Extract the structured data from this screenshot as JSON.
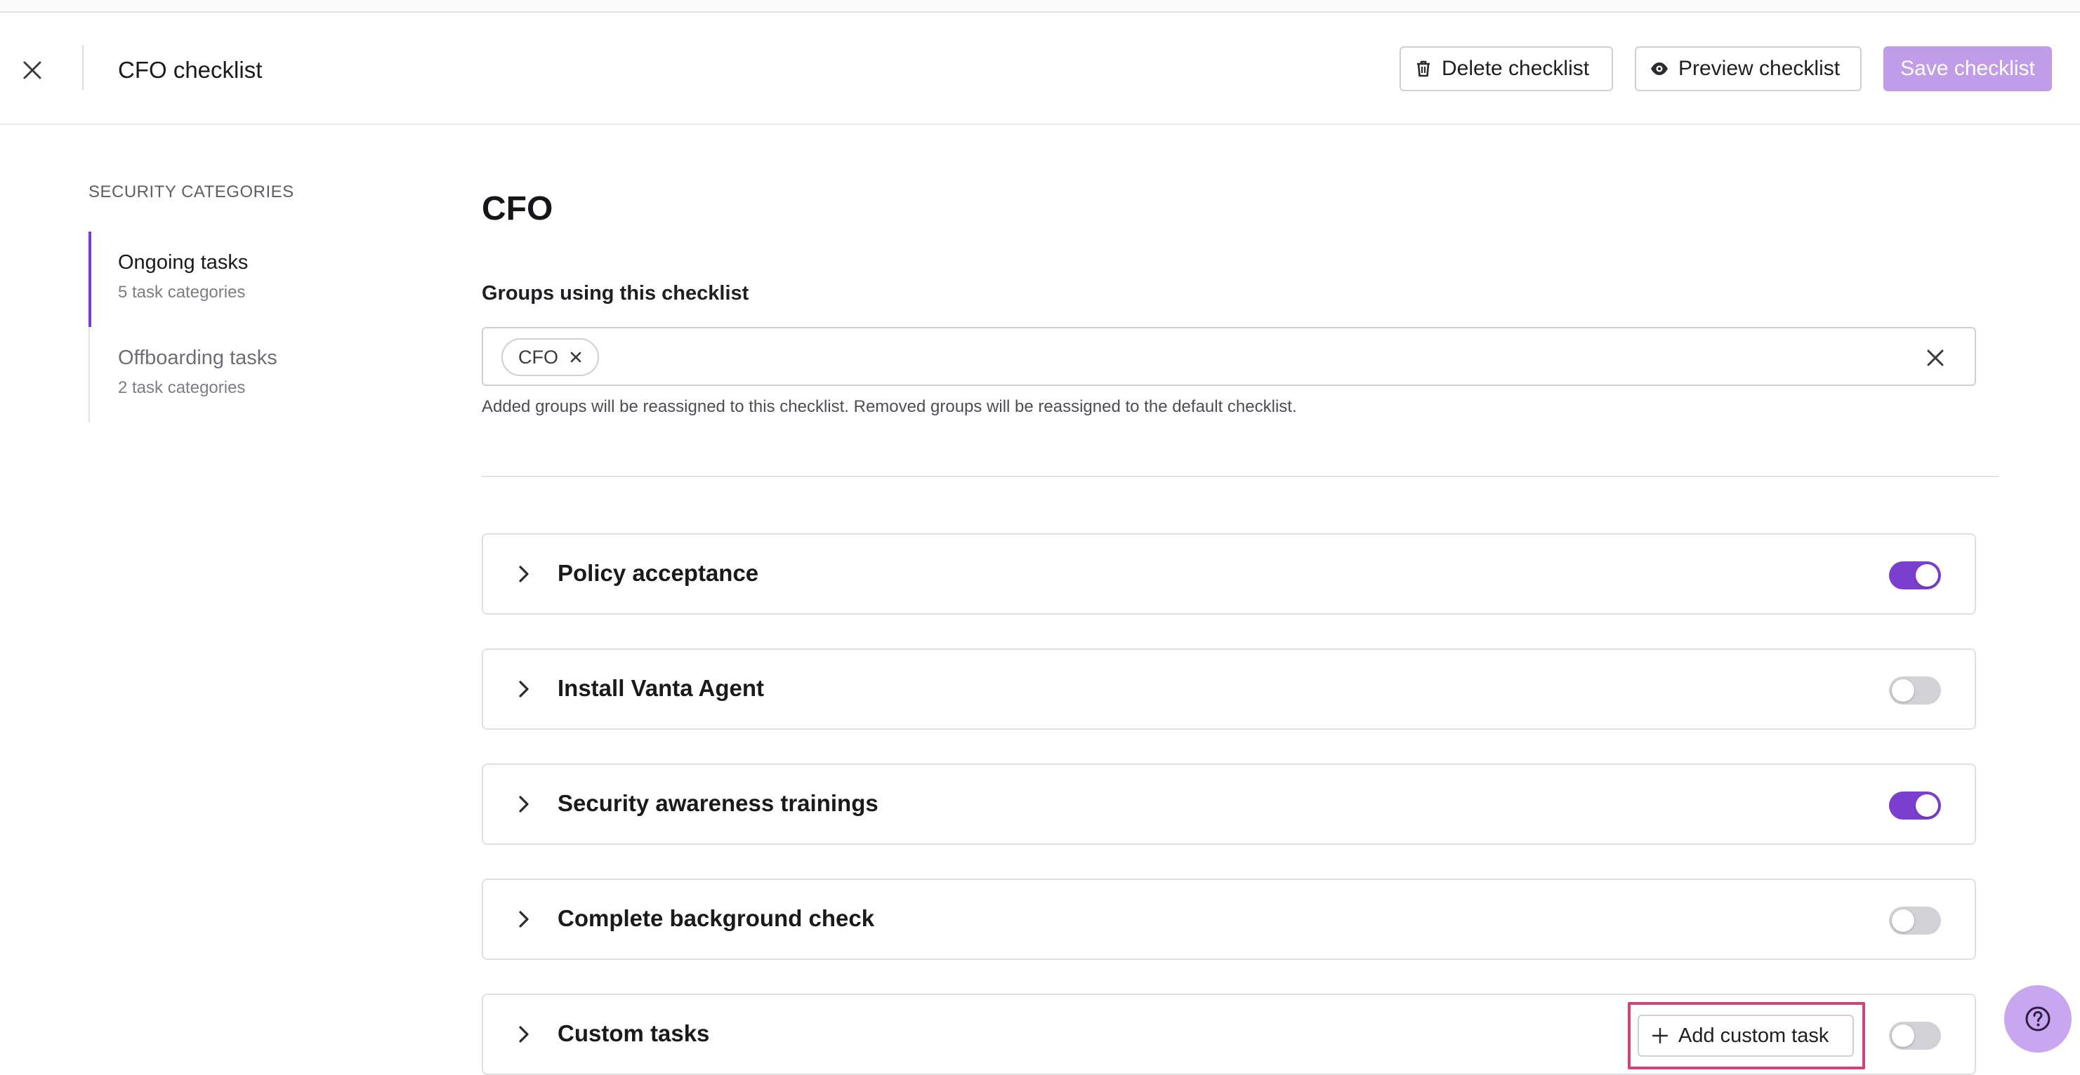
{
  "header": {
    "title": "CFO checklist",
    "delete_label": "Delete checklist",
    "preview_label": "Preview checklist",
    "save_label": "Save checklist"
  },
  "sidebar": {
    "heading": "SECURITY CATEGORIES",
    "items": [
      {
        "title": "Ongoing tasks",
        "subtitle": "5 task categories"
      },
      {
        "title": "Offboarding tasks",
        "subtitle": "2 task categories"
      }
    ]
  },
  "main": {
    "title": "CFO",
    "groups_label": "Groups using this checklist",
    "groups": [
      "CFO"
    ],
    "helper_text": "Added groups will be reassigned to this checklist. Removed groups will be reassigned to the default checklist.",
    "categories": [
      {
        "label": "Policy acceptance",
        "enabled": true
      },
      {
        "label": "Install Vanta Agent",
        "enabled": false
      },
      {
        "label": "Security awareness trainings",
        "enabled": true
      },
      {
        "label": "Complete background check",
        "enabled": false
      },
      {
        "label": "Custom tasks",
        "enabled": false
      }
    ],
    "add_custom_label": "Add custom task"
  },
  "colors": {
    "accent": "#7b3fd0",
    "save_disabled": "#c19ce9",
    "highlight": "#d0437a",
    "help_fab": "#c9a6f0"
  }
}
